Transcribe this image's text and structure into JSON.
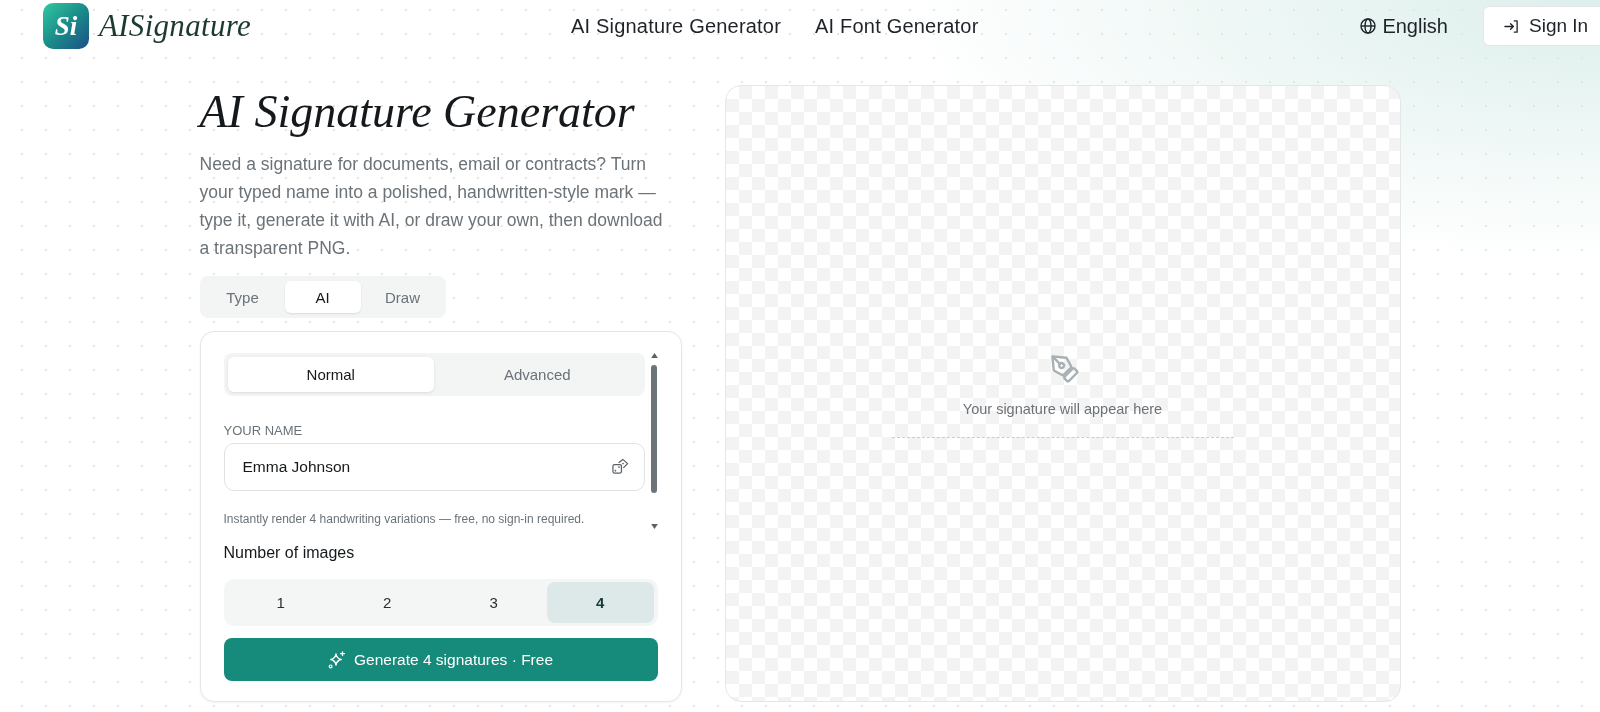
{
  "header": {
    "logo": {
      "mark": "Si",
      "name": "AISignature"
    },
    "nav": [
      {
        "label": "AI Signature Generator"
      },
      {
        "label": "AI Font Generator"
      }
    ],
    "language": "English",
    "sign_in": "Sign In"
  },
  "hero": {
    "title": "AI Signature Generator",
    "description": "Need a signature for documents, email or contracts? Turn your typed name into a polished, handwritten-style mark — type it, generate it with AI, or draw your own, then download a transparent PNG."
  },
  "mode_tabs": [
    {
      "label": "Type",
      "selected": false
    },
    {
      "label": "AI",
      "selected": true
    },
    {
      "label": "Draw",
      "selected": false
    }
  ],
  "generator": {
    "style_tabs": [
      {
        "label": "Normal",
        "selected": true
      },
      {
        "label": "Advanced",
        "selected": false
      }
    ],
    "name_field": {
      "label": "YOUR NAME",
      "value": "Emma Johnson"
    },
    "helper": "Instantly render 4 handwriting variations — free, no sign-in required.",
    "count_label": "Number of images",
    "counts": [
      {
        "label": "1",
        "selected": false
      },
      {
        "label": "2",
        "selected": false
      },
      {
        "label": "3",
        "selected": false
      },
      {
        "label": "4",
        "selected": true
      }
    ],
    "generate_button": "Generate 4 signatures · Free"
  },
  "preview": {
    "placeholder": "Your signature will appear here"
  }
}
